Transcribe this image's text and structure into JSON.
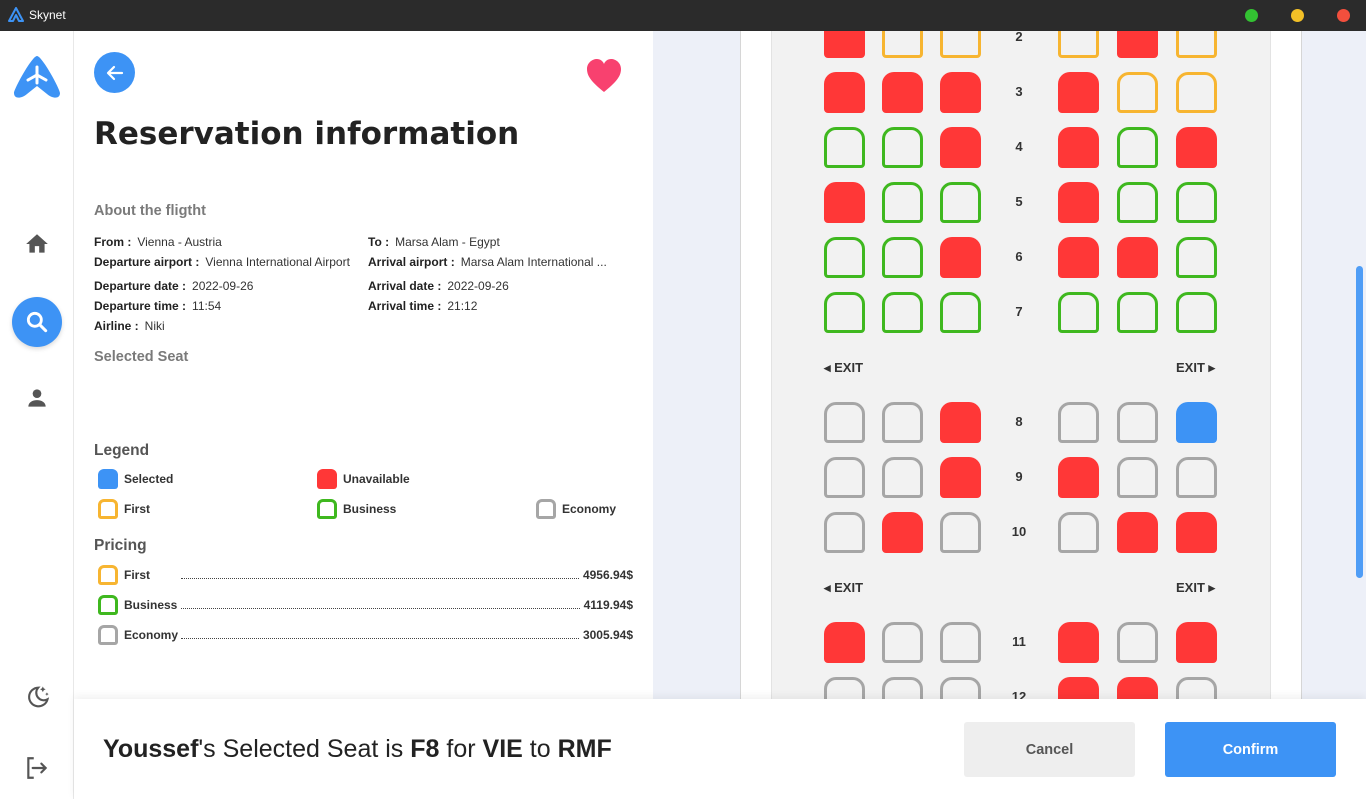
{
  "window": {
    "title": "Skynet",
    "controls": {
      "green": "#33c232",
      "yellow": "#f2c027",
      "red": "#f24f3d"
    }
  },
  "colors": {
    "accent": "#3d93f5",
    "unavailable": "#ff3737",
    "first": "#f7b531",
    "business": "#3fb81f",
    "economy": "#a6a6a6",
    "favorite": "#f8416f"
  },
  "sidebar": {
    "icons": [
      "home-icon",
      "search-icon",
      "user-icon",
      "moon-icon",
      "logout-icon"
    ],
    "active": "search-icon"
  },
  "header": {
    "title": "Reservation information"
  },
  "about": {
    "title": "About the fligtht",
    "from_label": "From :",
    "from": "Vienna - Austria",
    "to_label": "To :",
    "to": "Marsa Alam - Egypt",
    "dep_airport_label": "Departure airport :",
    "dep_airport": "Vienna International Airport",
    "arr_airport_label": "Arrival airport :",
    "arr_airport": "Marsa Alam International ...",
    "dep_date_label": "Departure date :",
    "dep_date": "2022-09-26",
    "arr_date_label": "Arrival date :",
    "arr_date": "2022-09-26",
    "dep_time_label": "Departure time :",
    "dep_time": "11:54",
    "arr_time_label": "Arrival time :",
    "arr_time": "21:12",
    "airline_label": "Airline :",
    "airline": "Niki"
  },
  "selected_seat": {
    "title": "Selected Seat"
  },
  "legend": {
    "title": "Legend",
    "selected": "Selected",
    "unavailable": "Unavailable",
    "first": "First",
    "business": "Business",
    "economy": "Economy"
  },
  "pricing": {
    "title": "Pricing",
    "rows": [
      {
        "class": "first",
        "label": "First",
        "amount": "4956.94$"
      },
      {
        "class": "bus",
        "label": "Business",
        "amount": "4119.94$"
      },
      {
        "class": "eco",
        "label": "Economy",
        "amount": "3005.94$"
      }
    ]
  },
  "seatmap": {
    "exit_left": "◂ EXIT",
    "exit_right": "EXIT ▸",
    "rows": [
      {
        "num": "2",
        "seats": [
          "una",
          "first",
          "first",
          "first",
          "una",
          "first"
        ]
      },
      {
        "num": "3",
        "seats": [
          "una",
          "una",
          "una",
          "una",
          "first",
          "first"
        ]
      },
      {
        "num": "4",
        "seats": [
          "bus",
          "bus",
          "una",
          "una",
          "bus",
          "una"
        ]
      },
      {
        "num": "5",
        "seats": [
          "una",
          "bus",
          "bus",
          "una",
          "bus",
          "bus"
        ]
      },
      {
        "num": "6",
        "seats": [
          "bus",
          "bus",
          "una",
          "una",
          "una",
          "bus"
        ]
      },
      {
        "num": "7",
        "seats": [
          "bus",
          "bus",
          "bus",
          "bus",
          "bus",
          "bus"
        ]
      },
      {
        "exit": true
      },
      {
        "num": "8",
        "seats": [
          "eco",
          "eco",
          "una",
          "eco",
          "eco",
          "sel"
        ]
      },
      {
        "num": "9",
        "seats": [
          "eco",
          "eco",
          "una",
          "una",
          "eco",
          "eco"
        ]
      },
      {
        "num": "10",
        "seats": [
          "eco",
          "una",
          "eco",
          "eco",
          "una",
          "una"
        ]
      },
      {
        "exit": true
      },
      {
        "num": "11",
        "seats": [
          "una",
          "eco",
          "eco",
          "una",
          "eco",
          "una"
        ]
      },
      {
        "num": "12",
        "seats": [
          "eco",
          "eco",
          "eco",
          "una",
          "una",
          "eco"
        ]
      }
    ]
  },
  "footer": {
    "user": "Youssef",
    "text1": "'s Selected Seat is ",
    "seat": "F8",
    "text2": " for ",
    "from_code": "VIE",
    "text3": " to ",
    "to_code": "RMF",
    "cancel": "Cancel",
    "confirm": "Confirm"
  }
}
